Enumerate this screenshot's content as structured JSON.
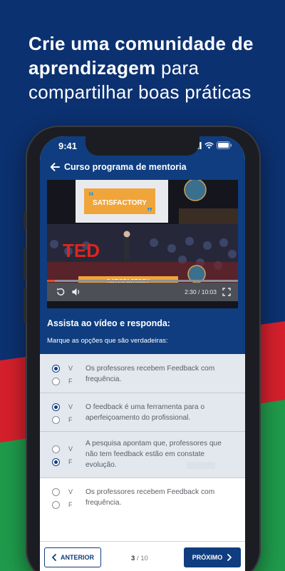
{
  "headline": {
    "line1": "Crie uma comunidade de",
    "line2_bold": "aprendizagem",
    "line2_rest": "para",
    "line3": "compartilhar boas práticas"
  },
  "status": {
    "time": "9:41"
  },
  "nav": {
    "title": "Curso programa de mentoria"
  },
  "video": {
    "time": "2:30 / 10:03",
    "slide_text": "SATISFACTORY",
    "logo_text": "TED",
    "progress_fraction": 0.04
  },
  "question": {
    "title": "Assista ao vídeo e responda:",
    "subtitle": "Marque as opções que são verdadeiras:"
  },
  "options": [
    {
      "v": "V",
      "f": "F",
      "text": "Os professores recebem Feedback com frequência.",
      "selected": "V"
    },
    {
      "v": "V",
      "f": "F",
      "text": "O feedback é uma ferramenta para o aperfeiçoamento do profissional.",
      "selected": "V"
    },
    {
      "v": "V",
      "f": "F",
      "text": "A pesquisa apontam que, professores que não tem feedback estão em constate evolução.",
      "selected": "F"
    },
    {
      "v": "V",
      "f": "F",
      "text": "Os professores recebem Feedback com frequência.",
      "selected": null
    }
  ],
  "footer": {
    "prev_label": "ANTERIOR",
    "next_label": "PRÓXIMO",
    "page_current": "3",
    "page_total": "/ 10"
  },
  "colors": {
    "brand_blue": "#0f3d7f",
    "background": "#0c3170",
    "red_band": "#d4202c",
    "green_band": "#1f9a4b",
    "selected_bg": "#e3e7ee"
  }
}
